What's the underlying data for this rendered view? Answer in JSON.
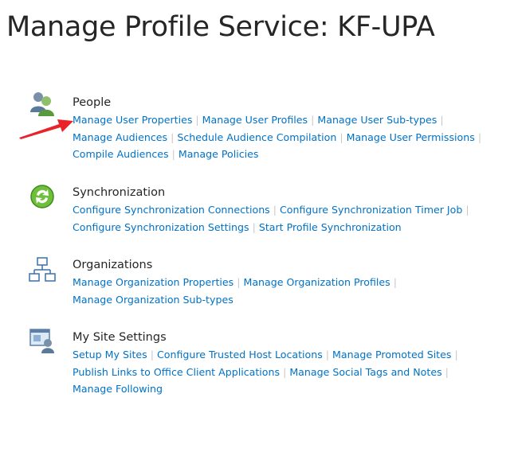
{
  "page": {
    "title": "Manage Profile Service: KF-UPA"
  },
  "sections": {
    "people": {
      "heading": "People",
      "icon": "people-icon",
      "links": [
        "Manage User Properties",
        "Manage User Profiles",
        "Manage User Sub-types",
        "Manage Audiences",
        "Schedule Audience Compilation",
        "Manage User Permissions",
        "Compile Audiences",
        "Manage Policies"
      ]
    },
    "synchronization": {
      "heading": "Synchronization",
      "icon": "sync-icon",
      "links": [
        "Configure Synchronization Connections",
        "Configure Synchronization Timer Job",
        "Configure Synchronization Settings",
        "Start Profile Synchronization"
      ]
    },
    "organizations": {
      "heading": "Organizations",
      "icon": "org-chart-icon",
      "links": [
        "Manage Organization Properties",
        "Manage Organization Profiles",
        "Manage Organization Sub-types"
      ]
    },
    "mysite": {
      "heading": "My Site Settings",
      "icon": "my-site-settings-icon",
      "links": [
        "Setup My Sites",
        "Configure Trusted Host Locations",
        "Manage Promoted Sites",
        "Publish Links to Office Client Applications",
        "Manage Social Tags and Notes",
        "Manage Following"
      ]
    }
  },
  "separator": "|",
  "colors": {
    "link": "#0072c6",
    "heading": "#262626",
    "separator": "#c8c8c8",
    "arrow": "#e8242a"
  }
}
